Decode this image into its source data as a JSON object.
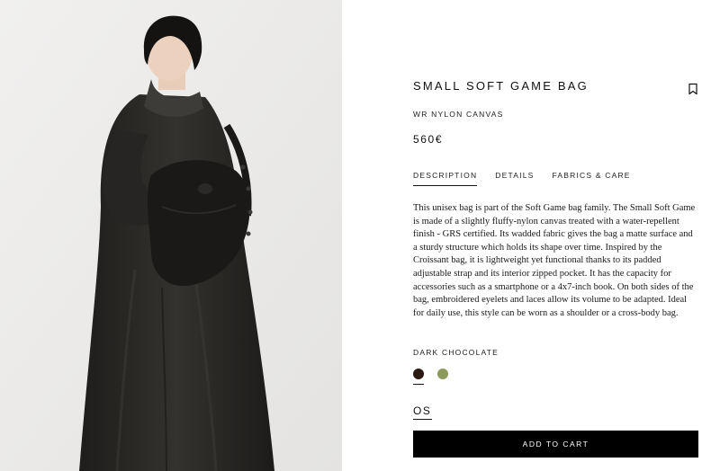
{
  "product": {
    "image_alt": "Model wearing the bag",
    "title": "SMALL SOFT GAME BAG",
    "material": "WR NYLON CANVAS",
    "price": "560€",
    "bookmark_icon": "bookmark-icon"
  },
  "tabs": [
    {
      "label": "DESCRIPTION",
      "active": true
    },
    {
      "label": "DETAILS",
      "active": false
    },
    {
      "label": "FABRICS & CARE",
      "active": false
    }
  ],
  "description": "This unisex bag is part of the Soft Game bag family. The Small Soft Game is made of a slightly fluffy-nylon canvas treated with a water-repellent finish - GRS certified. Its wadded fabric gives the bag a matte surface and a sturdy structure which holds its shape over time. Inspired by the Croissant bag, it is lightweight yet functional thanks to its padded adjustable strap and its interior zipped pocket. It has the capacity for accessories such as a smartphone or a 4x7-inch book. On both sides of the bag, embroidered eyelets and laces allow its volume to be adapted. Ideal for daily use, this style can be worn as a shoulder or a cross-body bag.",
  "color": {
    "selected_name": "DARK CHOCOLATE",
    "swatches": [
      {
        "name": "dark-chocolate",
        "hex": "#2a1a12",
        "selected": true
      },
      {
        "name": "olive",
        "hex": "#8a9a5b",
        "selected": false
      }
    ]
  },
  "size": {
    "selected": "OS"
  },
  "cta": {
    "label": "ADD TO CART"
  }
}
